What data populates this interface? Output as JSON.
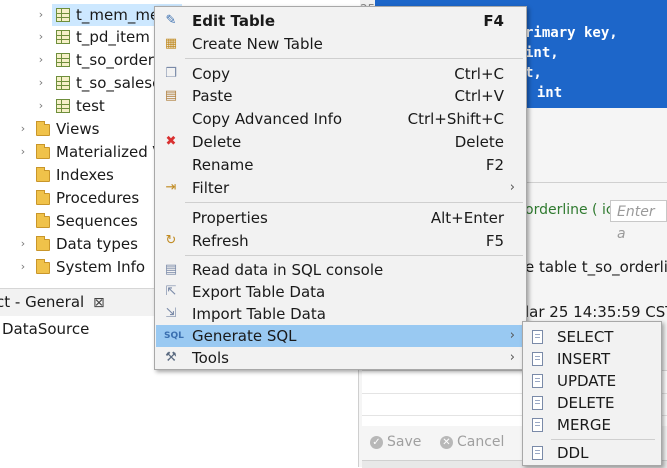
{
  "tree": {
    "tables": [
      "t_mem_me",
      "t_pd_item",
      "t_so_order",
      "t_so_salesc",
      "test"
    ],
    "folders": [
      "Views",
      "Materialized V",
      "Indexes",
      "Procedures",
      "Sequences",
      "Data types",
      "System Info"
    ]
  },
  "bottom_left": {
    "tab_label": "ct - General",
    "close_glyph": "⊠",
    "datasource": "DataSource"
  },
  "editor": {
    "line_number": "25",
    "lines": [
      "rimary key,",
      "int,",
      "t,",
      "  int"
    ]
  },
  "right_panel": {
    "orderline_tab": "orderline ( ic",
    "filter_placeholder": "Enter a",
    "sql_text": "e table t_so_orderli",
    "timestamp": "lar 25 14:35:59 CST",
    "save_label": "Save",
    "cancel_label": "Cancel"
  },
  "context_menu": {
    "edit_table": {
      "label": "Edit Table",
      "accel": "F4"
    },
    "create_new_table": {
      "label": "Create New Table"
    },
    "copy": {
      "label": "Copy",
      "accel": "Ctrl+C"
    },
    "paste": {
      "label": "Paste",
      "accel": "Ctrl+V"
    },
    "copy_advanced": {
      "label": "Copy Advanced Info",
      "accel": "Ctrl+Shift+C"
    },
    "delete": {
      "label": "Delete",
      "accel": "Delete"
    },
    "rename": {
      "label": "Rename",
      "accel": "F2"
    },
    "filter": {
      "label": "Filter",
      "submenu_glyph": "›"
    },
    "properties": {
      "label": "Properties",
      "accel": "Alt+Enter"
    },
    "refresh": {
      "label": "Refresh",
      "accel": "F5"
    },
    "read_data": {
      "label": "Read data in SQL console"
    },
    "export": {
      "label": "Export Table Data"
    },
    "import": {
      "label": "Import Table Data"
    },
    "generate_sql": {
      "label": "Generate SQL",
      "submenu_glyph": "›"
    },
    "tools": {
      "label": "Tools",
      "submenu_glyph": "›"
    }
  },
  "generate_sql_submenu": [
    "SELECT",
    "INSERT",
    "UPDATE",
    "DELETE",
    "MERGE",
    "DDL"
  ],
  "colors": {
    "menu_highlight": "#99c9f2",
    "editor_bg": "#1d66c9",
    "tree_selection": "#cde8ff"
  }
}
